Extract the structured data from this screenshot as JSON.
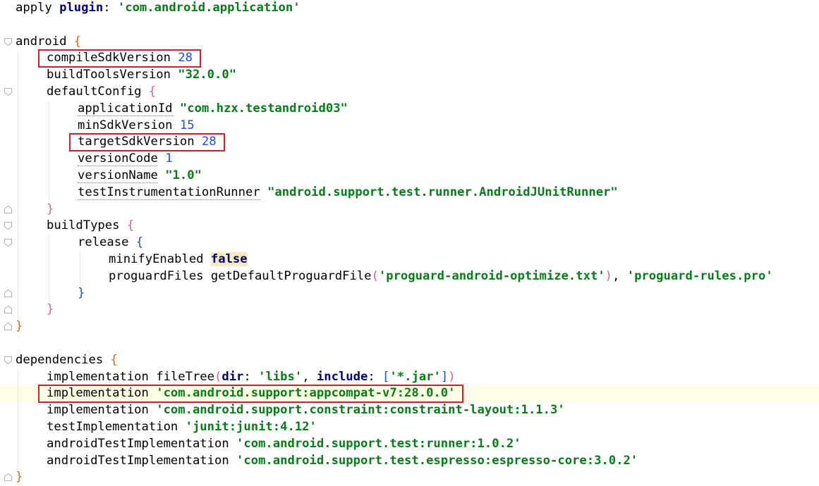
{
  "editor": {
    "language": "gradle",
    "lines": [
      {
        "indent": 0,
        "fold": "",
        "tokens": [
          [
            "plain",
            "apply "
          ],
          [
            "kw",
            "plugin"
          ],
          [
            "plain",
            ": "
          ],
          [
            "str",
            "'com.android.application'"
          ]
        ]
      },
      {
        "indent": 0,
        "fold": "",
        "tokens": []
      },
      {
        "indent": 0,
        "fold": "open",
        "tokens": [
          [
            "plain",
            "android "
          ],
          [
            "brace-o",
            "{"
          ]
        ]
      },
      {
        "indent": 1,
        "fold": "",
        "highlight": true,
        "tokens": [
          [
            "plain",
            "compileSdkVersion "
          ],
          [
            "num",
            "28"
          ]
        ]
      },
      {
        "indent": 1,
        "fold": "",
        "tokens": [
          [
            "plain",
            "buildToolsVersion "
          ],
          [
            "str",
            "\"32.0.0\""
          ]
        ]
      },
      {
        "indent": 1,
        "fold": "open",
        "tokens": [
          [
            "plain",
            "defaultConfig "
          ],
          [
            "brace-p",
            "{"
          ]
        ]
      },
      {
        "indent": 2,
        "fold": "",
        "tokens": [
          [
            "dotted",
            "applicationId"
          ],
          [
            "plain",
            " "
          ],
          [
            "str",
            "\"com.hzx.testandroid03\""
          ]
        ]
      },
      {
        "indent": 2,
        "fold": "",
        "tokens": [
          [
            "plain",
            "minSdkVersion "
          ],
          [
            "num",
            "15"
          ]
        ]
      },
      {
        "indent": 2,
        "fold": "",
        "highlight": true,
        "tokens": [
          [
            "plain",
            "targetSdkVersion "
          ],
          [
            "num",
            "28"
          ]
        ]
      },
      {
        "indent": 2,
        "fold": "",
        "tokens": [
          [
            "dotted",
            "versionCode"
          ],
          [
            "plain",
            " "
          ],
          [
            "num",
            "1"
          ]
        ]
      },
      {
        "indent": 2,
        "fold": "",
        "tokens": [
          [
            "dotted",
            "versionName"
          ],
          [
            "plain",
            " "
          ],
          [
            "str",
            "\"1.0\""
          ]
        ]
      },
      {
        "indent": 2,
        "fold": "",
        "tokens": [
          [
            "dotted",
            "testInstrumentationRunner"
          ],
          [
            "plain",
            " "
          ],
          [
            "str",
            "\"android.support.test.runner.AndroidJUnitRunner\""
          ]
        ]
      },
      {
        "indent": 1,
        "fold": "close",
        "tokens": [
          [
            "brace-p",
            "}"
          ]
        ]
      },
      {
        "indent": 1,
        "fold": "open",
        "tokens": [
          [
            "plain",
            "buildTypes "
          ],
          [
            "brace-p",
            "{"
          ]
        ]
      },
      {
        "indent": 2,
        "fold": "open",
        "tokens": [
          [
            "plain",
            "release "
          ],
          [
            "brace-b",
            "{"
          ]
        ]
      },
      {
        "indent": 3,
        "fold": "",
        "tokens": [
          [
            "plain",
            "minifyEnabled "
          ],
          [
            "bool",
            "false"
          ]
        ]
      },
      {
        "indent": 3,
        "fold": "",
        "tokens": [
          [
            "plain",
            "proguardFiles getDefaultProguardFile"
          ],
          [
            "brace-p",
            "("
          ],
          [
            "str",
            "'proguard-android-optimize.txt'"
          ],
          [
            "brace-p",
            ")"
          ],
          [
            "plain",
            ", "
          ],
          [
            "str",
            "'proguard-rules.pro'"
          ]
        ]
      },
      {
        "indent": 2,
        "fold": "close",
        "tokens": [
          [
            "brace-b",
            "}"
          ]
        ]
      },
      {
        "indent": 1,
        "fold": "close",
        "tokens": [
          [
            "brace-p",
            "}"
          ]
        ]
      },
      {
        "indent": 0,
        "fold": "close",
        "tokens": [
          [
            "brace-o",
            "}"
          ]
        ]
      },
      {
        "indent": 0,
        "fold": "",
        "tokens": []
      },
      {
        "indent": 0,
        "fold": "open",
        "tokens": [
          [
            "plain",
            "dependencies "
          ],
          [
            "brace-o",
            "{"
          ]
        ]
      },
      {
        "indent": 1,
        "fold": "",
        "tokens": [
          [
            "plain",
            "implementation fileTree"
          ],
          [
            "brace-p",
            "("
          ],
          [
            "kw",
            "dir"
          ],
          [
            "plain",
            ": "
          ],
          [
            "str",
            "'libs'"
          ],
          [
            "plain",
            ", "
          ],
          [
            "kw",
            "include"
          ],
          [
            "plain",
            ": "
          ],
          [
            "brace-b",
            "["
          ],
          [
            "str",
            "'*.jar'"
          ],
          [
            "brace-b",
            "]"
          ],
          [
            "brace-p",
            ")"
          ]
        ]
      },
      {
        "indent": 1,
        "fold": "",
        "current": true,
        "highlight": true,
        "tokens": [
          [
            "plain",
            "implementation "
          ],
          [
            "str",
            "'com.android.support:appcompat-v7:28.0.0'"
          ]
        ]
      },
      {
        "indent": 1,
        "fold": "",
        "tokens": [
          [
            "plain",
            "implementation "
          ],
          [
            "str",
            "'com.android.support.constraint:constraint-layout:1.1.3'"
          ]
        ]
      },
      {
        "indent": 1,
        "fold": "",
        "tokens": [
          [
            "plain",
            "testImplementation "
          ],
          [
            "str",
            "'junit:junit:4.12'"
          ]
        ]
      },
      {
        "indent": 1,
        "fold": "",
        "tokens": [
          [
            "plain",
            "androidTestImplementation "
          ],
          [
            "str",
            "'com.android.support.test:runner:1.0.2'"
          ]
        ]
      },
      {
        "indent": 1,
        "fold": "",
        "tokens": [
          [
            "plain",
            "androidTestImplementation "
          ],
          [
            "str",
            "'com.android.support.test.espresso:espresso-core:3.0.2'"
          ]
        ]
      },
      {
        "indent": 0,
        "fold": "close",
        "tokens": [
          [
            "brace-o",
            "}"
          ]
        ]
      }
    ]
  }
}
